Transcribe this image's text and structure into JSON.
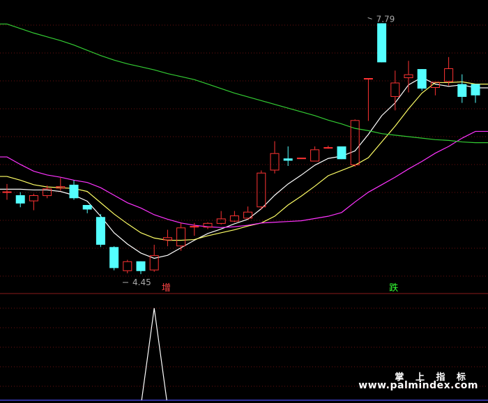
{
  "chart_data": {
    "type": "candlestick",
    "price_range": [
      4.2,
      8.1
    ],
    "candles": [
      {
        "o": 5.55,
        "h": 5.65,
        "l": 5.44,
        "c": 5.55
      },
      {
        "o": 5.5,
        "h": 5.54,
        "l": 5.34,
        "c": 5.39
      },
      {
        "o": 5.42,
        "h": 5.52,
        "l": 5.3,
        "c": 5.5
      },
      {
        "o": 5.49,
        "h": 5.63,
        "l": 5.46,
        "c": 5.59
      },
      {
        "o": 5.59,
        "h": 5.73,
        "l": 5.56,
        "c": 5.62
      },
      {
        "o": 5.64,
        "h": 5.7,
        "l": 5.44,
        "c": 5.46
      },
      {
        "o": 5.37,
        "h": 5.37,
        "l": 5.26,
        "c": 5.31
      },
      {
        "o": 5.21,
        "h": 5.25,
        "l": 4.81,
        "c": 4.84
      },
      {
        "o": 4.81,
        "h": 4.82,
        "l": 4.5,
        "c": 4.53
      },
      {
        "o": 4.49,
        "h": 4.64,
        "l": 4.46,
        "c": 4.62
      },
      {
        "o": 4.62,
        "h": 4.62,
        "l": 4.45,
        "c": 4.49
      },
      {
        "o": 4.5,
        "h": 4.84,
        "l": 4.48,
        "c": 4.7
      },
      {
        "o": 4.9,
        "h": 5.04,
        "l": 4.82,
        "c": 4.94
      },
      {
        "o": 4.82,
        "h": 5.13,
        "l": 4.76,
        "c": 5.07
      },
      {
        "o": 5.09,
        "h": 5.13,
        "l": 4.96,
        "c": 5.09
      },
      {
        "o": 5.07,
        "h": 5.14,
        "l": 5.05,
        "c": 5.13
      },
      {
        "o": 5.12,
        "h": 5.29,
        "l": 5.11,
        "c": 5.19
      },
      {
        "o": 5.15,
        "h": 5.29,
        "l": 5.14,
        "c": 5.23
      },
      {
        "o": 5.19,
        "h": 5.35,
        "l": 5.18,
        "c": 5.28
      },
      {
        "o": 5.34,
        "h": 5.83,
        "l": 5.31,
        "c": 5.8
      },
      {
        "o": 5.83,
        "h": 6.22,
        "l": 5.79,
        "c": 6.06
      },
      {
        "o": 5.99,
        "h": 6.15,
        "l": 5.89,
        "c": 5.96
      },
      {
        "o": 5.99,
        "h": 6.0,
        "l": 5.99,
        "c": 6.0
      },
      {
        "o": 5.95,
        "h": 6.15,
        "l": 5.95,
        "c": 6.11
      },
      {
        "o": 6.14,
        "h": 6.16,
        "l": 6.12,
        "c": 6.14
      },
      {
        "o": 6.15,
        "h": 6.15,
        "l": 5.98,
        "c": 5.98
      },
      {
        "o": 5.9,
        "h": 6.51,
        "l": 5.88,
        "c": 6.5
      },
      {
        "o": 7.06,
        "h": 7.06,
        "l": 6.49,
        "c": 7.06
      },
      {
        "o": 7.79,
        "h": 7.79,
        "l": 7.27,
        "c": 7.27
      },
      {
        "o": 6.81,
        "h": 7.16,
        "l": 6.63,
        "c": 7.0
      },
      {
        "o": 7.06,
        "h": 7.29,
        "l": 6.87,
        "c": 7.11
      },
      {
        "o": 7.18,
        "h": 7.18,
        "l": 6.89,
        "c": 6.92
      },
      {
        "o": 6.93,
        "h": 7.01,
        "l": 6.83,
        "c": 7.01
      },
      {
        "o": 7.01,
        "h": 7.34,
        "l": 6.96,
        "c": 7.19
      },
      {
        "o": 6.98,
        "h": 7.11,
        "l": 6.73,
        "c": 6.81
      },
      {
        "o": 6.98,
        "h": 6.98,
        "l": 6.73,
        "c": 6.83
      }
    ],
    "ma_lines": [
      {
        "color": "#ffffff",
        "values": [
          5.58,
          5.58,
          5.57,
          5.57,
          5.55,
          5.5,
          5.42,
          5.22,
          5.0,
          4.85,
          4.73,
          4.66,
          4.7,
          4.8,
          4.9,
          4.99,
          5.05,
          5.12,
          5.18,
          5.32,
          5.5,
          5.65,
          5.77,
          5.9,
          5.99,
          6.02,
          6.09,
          6.31,
          6.56,
          6.73,
          6.97,
          7.07,
          6.98,
          6.95,
          6.97,
          6.93
        ]
      },
      {
        "color": "#ffff66",
        "values": [
          5.75,
          5.7,
          5.64,
          5.61,
          5.6,
          5.59,
          5.55,
          5.4,
          5.25,
          5.12,
          5.0,
          4.93,
          4.9,
          4.9,
          4.91,
          4.96,
          5.0,
          5.04,
          5.09,
          5.13,
          5.22,
          5.37,
          5.49,
          5.62,
          5.76,
          5.83,
          5.9,
          6.0,
          6.21,
          6.42,
          6.65,
          6.86,
          7.0,
          7.0,
          7.01,
          6.98
        ]
      },
      {
        "color": "#ff33ff",
        "values": [
          6.01,
          5.91,
          5.82,
          5.77,
          5.74,
          5.7,
          5.67,
          5.6,
          5.5,
          5.4,
          5.33,
          5.24,
          5.18,
          5.13,
          5.1,
          5.08,
          5.07,
          5.08,
          5.1,
          5.13,
          5.14,
          5.15,
          5.16,
          5.19,
          5.22,
          5.27,
          5.41,
          5.54,
          5.64,
          5.74,
          5.85,
          5.95,
          6.06,
          6.15,
          6.26,
          6.35
        ]
      },
      {
        "color": "#33cc33",
        "values": [
          7.78,
          7.72,
          7.66,
          7.61,
          7.56,
          7.5,
          7.43,
          7.36,
          7.3,
          7.25,
          7.21,
          7.17,
          7.12,
          7.08,
          7.04,
          6.98,
          6.92,
          6.86,
          6.81,
          6.76,
          6.71,
          6.66,
          6.61,
          6.56,
          6.5,
          6.45,
          6.39,
          6.36,
          6.32,
          6.3,
          6.28,
          6.26,
          6.24,
          6.23,
          6.21,
          6.2
        ]
      }
    ],
    "annotations": {
      "high": "7.79",
      "low": "4.45"
    },
    "signals": [
      {
        "label": "增",
        "index": 12,
        "color": "#ff4444"
      },
      {
        "label": "跌",
        "index": 29,
        "color": "#33ff33"
      }
    ],
    "indicator": {
      "peak_index": 11,
      "peak_value": 1
    }
  },
  "watermark": {
    "line1": "掌 上 指 标",
    "line2": "www.palmindex.com"
  },
  "colors": {
    "up": "#ff3333",
    "down": "#54ffff",
    "grid": "#6e1010",
    "bg": "#000000",
    "indicator": "#ffffff"
  }
}
